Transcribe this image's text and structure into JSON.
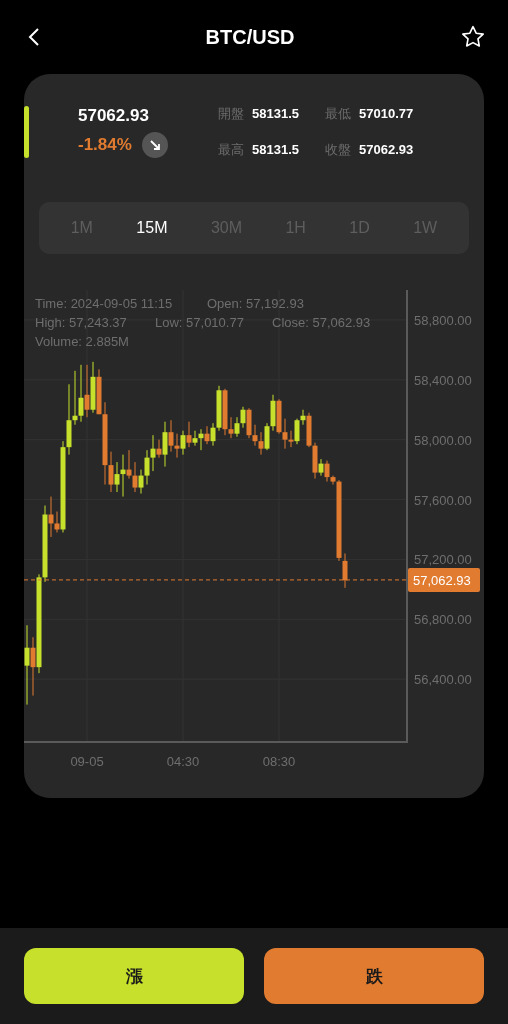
{
  "header": {
    "title": "BTC/USD"
  },
  "quote": {
    "price": "57062.93",
    "change": "-1.84%"
  },
  "stats": [
    {
      "label": "開盤",
      "value": "58131.5"
    },
    {
      "label": "最低",
      "value": "57010.77"
    },
    {
      "label": "最高",
      "value": "58131.5"
    },
    {
      "label": "收盤",
      "value": "57062.93"
    }
  ],
  "intervals": [
    {
      "label": "1M",
      "selected": false
    },
    {
      "label": "15M",
      "selected": true
    },
    {
      "label": "30M",
      "selected": false
    },
    {
      "label": "1H",
      "selected": false
    },
    {
      "label": "1D",
      "selected": false
    },
    {
      "label": "1W",
      "selected": false
    }
  ],
  "chart": {
    "info": [
      "Time: 2024-09-05 11:15",
      "Open: 57,192.93",
      "High: 57,243.37",
      "Low: 57,010.77",
      "Close: 57,062.93",
      "Volume: 2.885M"
    ],
    "chart_data": {
      "type": "candlestick",
      "grid": true,
      "ref_lines": [
        {
          "axis": "y",
          "value": 57062.93,
          "label": "57,062.93"
        }
      ],
      "categories": [
        null,
        null,
        null,
        null,
        null,
        null,
        null,
        null,
        null,
        null,
        "09-05",
        null,
        null,
        null,
        null,
        null,
        null,
        null,
        null,
        null,
        null,
        null,
        null,
        null,
        null,
        null,
        "04:30",
        null,
        null,
        null,
        null,
        null,
        null,
        null,
        null,
        null,
        null,
        null,
        null,
        null,
        null,
        null,
        "08:30",
        null,
        null,
        null,
        null,
        null,
        null,
        null,
        null,
        null,
        null,
        null
      ],
      "ylim": [
        55980,
        59000
      ],
      "yticks": [
        {
          "value": 58800,
          "label": "58,800.00"
        },
        {
          "value": 58400,
          "label": "58,400.00"
        },
        {
          "value": 58000,
          "label": "58,000.00"
        },
        {
          "value": 57600,
          "label": "57,600.00"
        },
        {
          "value": 57200,
          "label": "57,200.00"
        },
        {
          "value": 56800,
          "label": "56,800.00"
        },
        {
          "value": 56400,
          "label": "56,400.00"
        }
      ],
      "ohlc": [
        [
          56490,
          56760,
          56230,
          56610
        ],
        [
          56610,
          56680,
          56290,
          56480
        ],
        [
          56480,
          57100,
          56440,
          57080
        ],
        [
          57080,
          57560,
          57050,
          57500
        ],
        [
          57500,
          57620,
          57350,
          57440
        ],
        [
          57440,
          57520,
          57380,
          57400
        ],
        [
          57400,
          57990,
          57380,
          57950
        ],
        [
          57950,
          58370,
          57900,
          58130
        ],
        [
          58130,
          58460,
          58100,
          58160
        ],
        [
          58160,
          58500,
          58120,
          58280
        ],
        [
          58300,
          58500,
          58150,
          58200
        ],
        [
          58200,
          58520,
          58180,
          58420
        ],
        [
          58420,
          58470,
          58170,
          58170
        ],
        [
          58170,
          58250,
          57700,
          57830
        ],
        [
          57830,
          57920,
          57650,
          57700
        ],
        [
          57700,
          57850,
          57650,
          57770
        ],
        [
          57770,
          57900,
          57620,
          57800
        ],
        [
          57800,
          57930,
          57740,
          57760
        ],
        [
          57760,
          57850,
          57650,
          57680
        ],
        [
          57680,
          57800,
          57640,
          57760
        ],
        [
          57760,
          57930,
          57700,
          57880
        ],
        [
          57880,
          58030,
          57790,
          57940
        ],
        [
          57940,
          58000,
          57880,
          57900
        ],
        [
          57900,
          58120,
          57820,
          58050
        ],
        [
          58050,
          58130,
          57920,
          57960
        ],
        [
          57960,
          58040,
          57880,
          57940
        ],
        [
          57940,
          58060,
          57900,
          58030
        ],
        [
          58030,
          58120,
          57950,
          57980
        ],
        [
          57980,
          58060,
          57960,
          58010
        ],
        [
          58010,
          58070,
          57930,
          58040
        ],
        [
          58040,
          58090,
          57970,
          57990
        ],
        [
          57990,
          58110,
          57960,
          58080
        ],
        [
          58080,
          58360,
          58060,
          58330
        ],
        [
          58330,
          58340,
          58030,
          58070
        ],
        [
          58070,
          58150,
          58010,
          58040
        ],
        [
          58040,
          58150,
          58020,
          58110
        ],
        [
          58110,
          58220,
          58080,
          58200
        ],
        [
          58200,
          58210,
          58010,
          58030
        ],
        [
          58030,
          58100,
          57960,
          57990
        ],
        [
          57990,
          58050,
          57900,
          57940
        ],
        [
          57940,
          58110,
          57930,
          58090
        ],
        [
          58090,
          58300,
          58060,
          58260
        ],
        [
          58260,
          58270,
          58040,
          58050
        ],
        [
          58050,
          58140,
          57940,
          58000
        ],
        [
          58000,
          58060,
          57950,
          57990
        ],
        [
          57990,
          58140,
          57970,
          58130
        ],
        [
          58130,
          58200,
          58100,
          58160
        ],
        [
          58160,
          58180,
          57950,
          57960
        ],
        [
          57960,
          57980,
          57740,
          57780
        ],
        [
          57780,
          57870,
          57760,
          57840
        ],
        [
          57840,
          57860,
          57720,
          57750
        ],
        [
          57750,
          57760,
          57700,
          57720
        ],
        [
          57720,
          57730,
          57190,
          57210
        ],
        [
          57190,
          57240,
          57010,
          57060
        ]
      ]
    }
  },
  "actions": [
    {
      "label": "漲",
      "kind": "buy"
    },
    {
      "label": "跌",
      "kind": "sell"
    }
  ]
}
